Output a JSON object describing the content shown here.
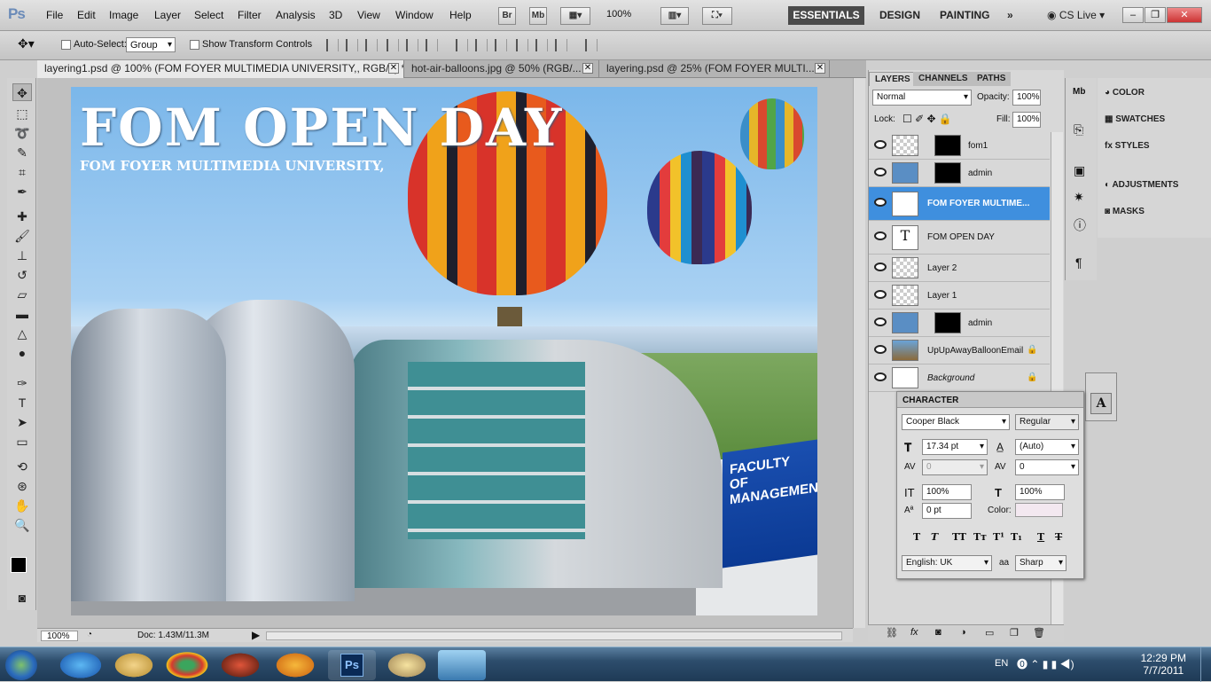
{
  "app": {
    "logo": "Ps"
  },
  "menu": [
    "File",
    "Edit",
    "Image",
    "Layer",
    "Select",
    "Filter",
    "Analysis",
    "3D",
    "View",
    "Window",
    "Help"
  ],
  "appbar": {
    "br": "Br",
    "mb": "Mb",
    "zoom": "100%",
    "workspaces": [
      "ESSENTIALS",
      "DESIGN",
      "PAINTING"
    ],
    "cslive": "CS Live"
  },
  "options": {
    "autoselect_label": "Auto-Select:",
    "autoselect_value": "Group",
    "transform_label": "Show Transform Controls"
  },
  "tabs": [
    {
      "label": "layering1.psd @ 100% (FOM FOYER MULTIMEDIA UNIVERSITY,, RGB/8) *"
    },
    {
      "label": "hot-air-balloons.jpg @ 50% (RGB/..."
    },
    {
      "label": "layering.psd @ 25% (FOM FOYER MULTI..."
    }
  ],
  "canvas": {
    "title": "FOM OPEN DAY",
    "subtitle": "FOM FOYER MULTIMEDIA UNIVERSITY,",
    "sign": "FACULTY OF MANAGEMENT"
  },
  "status": {
    "zoom": "100%",
    "doc": "Doc: 1.43M/11.3M"
  },
  "layers": {
    "tabs": [
      "LAYERS",
      "CHANNELS",
      "PATHS"
    ],
    "blend": "Normal",
    "opacity_label": "Opacity:",
    "opacity": "100%",
    "lock_label": "Lock:",
    "fill_label": "Fill:",
    "fill": "100%",
    "items": [
      {
        "name": "fom1"
      },
      {
        "name": "admin"
      },
      {
        "name": "FOM FOYER MULTIME..."
      },
      {
        "name": "FOM OPEN DAY"
      },
      {
        "name": "Layer 2"
      },
      {
        "name": "Layer 1"
      },
      {
        "name": "admin"
      },
      {
        "name": "UpUpAwayBalloonEmail"
      },
      {
        "name": "Background"
      }
    ]
  },
  "dock": [
    "COLOR",
    "SWATCHES",
    "STYLES",
    "ADJUSTMENTS",
    "MASKS"
  ],
  "character": {
    "title": "CHARACTER",
    "font": "Cooper Black",
    "style": "Regular",
    "size": "17.34 pt",
    "leading": "(Auto)",
    "kerning": "0",
    "tracking": "0",
    "vscale": "100%",
    "hscale": "100%",
    "baseline": "0 pt",
    "color_label": "Color:",
    "language": "English: UK",
    "aa_label": "aa",
    "antialias": "Sharp"
  },
  "taskbar": {
    "lang": "EN",
    "time": "12:29 PM",
    "date": "7/7/2011",
    "ps": "Ps"
  }
}
